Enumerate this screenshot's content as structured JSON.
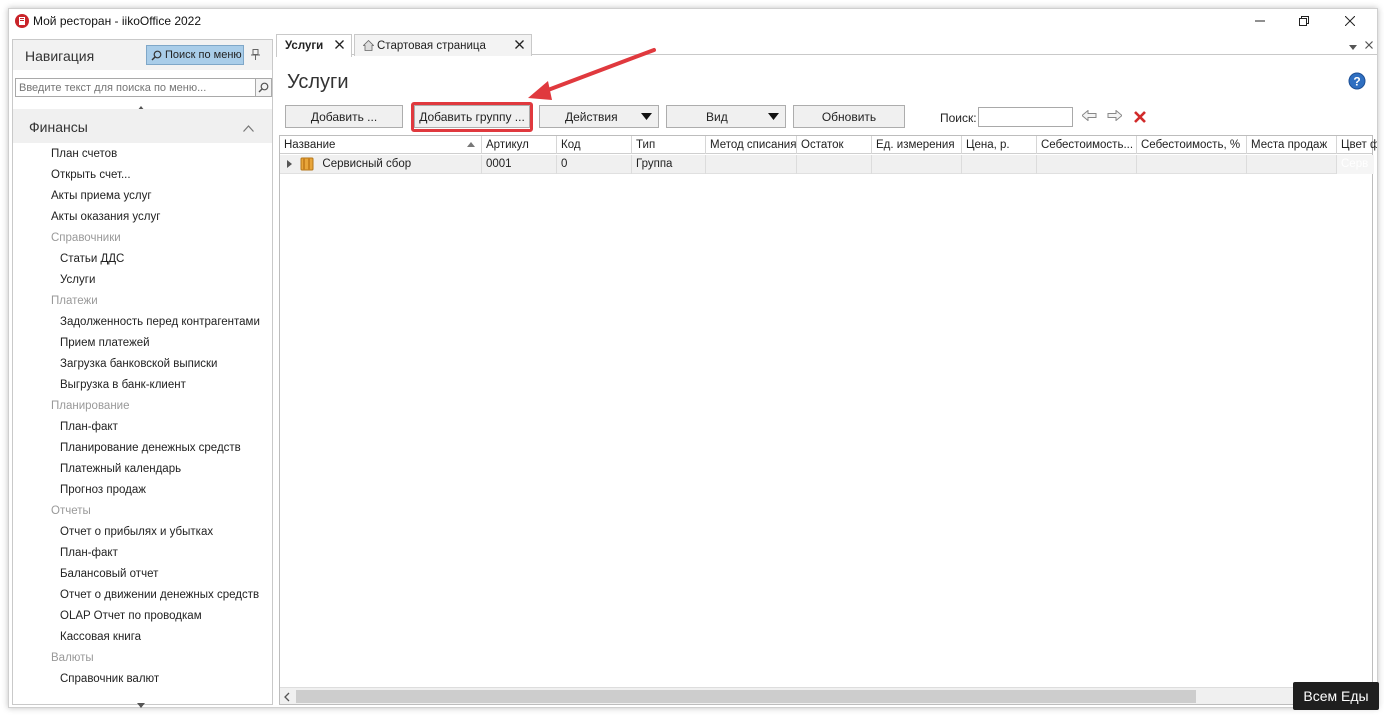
{
  "window": {
    "title": "Мой ресторан - iikoOffice 2022"
  },
  "nav": {
    "title": "Навигация",
    "search_button": "Поиск по меню",
    "search_placeholder": "Введите текст для поиска по меню...",
    "section": "Финансы",
    "items": [
      {
        "label": "План счетов",
        "level": 1
      },
      {
        "label": "Открыть счет...",
        "level": 1
      },
      {
        "label": "Акты приема услуг",
        "level": 1
      },
      {
        "label": "Акты оказания услуг",
        "level": 1
      },
      {
        "label": "Справочники",
        "level": 0
      },
      {
        "label": "Статьи ДДС",
        "level": 2
      },
      {
        "label": "Услуги",
        "level": 2
      },
      {
        "label": "Платежи",
        "level": 0
      },
      {
        "label": "Задолженность перед контрагентами",
        "level": 2
      },
      {
        "label": "Прием платежей",
        "level": 2
      },
      {
        "label": "Загрузка банковской выписки",
        "level": 2
      },
      {
        "label": "Выгрузка в банк-клиент",
        "level": 2
      },
      {
        "label": "Планирование",
        "level": 0
      },
      {
        "label": "План-факт",
        "level": 2
      },
      {
        "label": "Планирование денежных средств",
        "level": 2
      },
      {
        "label": "Платежный календарь",
        "level": 2
      },
      {
        "label": "Прогноз продаж",
        "level": 2
      },
      {
        "label": "Отчеты",
        "level": 0
      },
      {
        "label": "Отчет о прибылях и убытках",
        "level": 2
      },
      {
        "label": "План-факт",
        "level": 2
      },
      {
        "label": "Балансовый отчет",
        "level": 2
      },
      {
        "label": "Отчет о движении денежных средств",
        "level": 2
      },
      {
        "label": "OLAP Отчет по проводкам",
        "level": 2
      },
      {
        "label": "Кассовая книга",
        "level": 2
      },
      {
        "label": "Валюты",
        "level": 0
      },
      {
        "label": "Справочник валют",
        "level": 2
      }
    ]
  },
  "tabs": [
    {
      "label": "Услуги",
      "active": true
    },
    {
      "label": "Стартовая страница",
      "active": false
    }
  ],
  "page": {
    "title": "Услуги"
  },
  "toolbar": {
    "add": "Добавить ...",
    "add_group": "Добавить группу ...",
    "actions": "Действия",
    "view": "Вид",
    "refresh": "Обновить",
    "search_label": "Поиск:"
  },
  "grid": {
    "columns": [
      "Название",
      "Артикул",
      "Код",
      "Тип",
      "Метод списания",
      "Остаток",
      "Ед. измерения",
      "Цена, р.",
      "Себестоимость...",
      "Себестоимость, %",
      "Места продаж",
      "Цвет ф"
    ],
    "rows": [
      {
        "name": "Сервисный сбор",
        "article": "0001",
        "code": "0",
        "type": "Группа",
        "color_cell": "Серв"
      }
    ]
  },
  "badge": "Всем Еды",
  "colors": {
    "accent": "#a9cde9",
    "highlight": "#e0393e",
    "folder": "#e8a53a"
  }
}
